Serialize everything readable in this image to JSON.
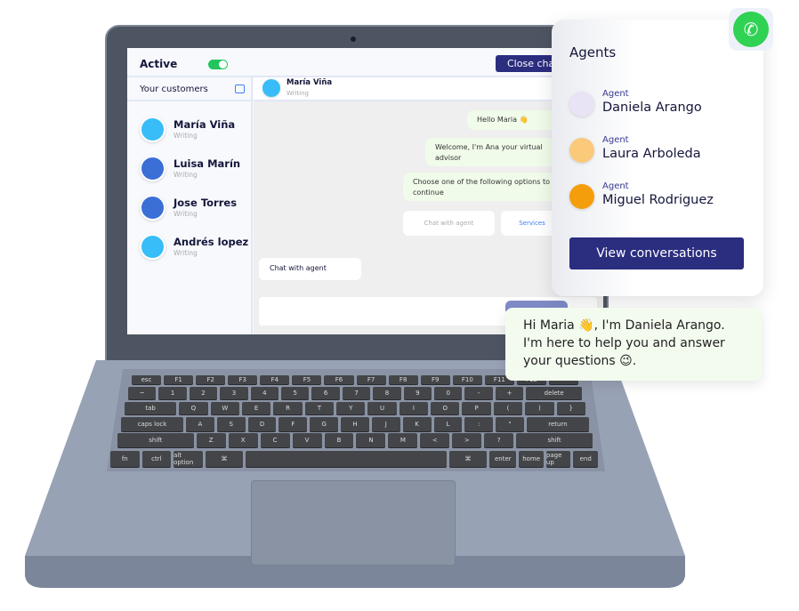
{
  "screen": {
    "active_label": "Active",
    "active_on": true,
    "close_chat": "Close chat",
    "your_customers": "Your customers",
    "customers": [
      {
        "name": "María Viña",
        "status": "Writing",
        "color": "#38bdf8"
      },
      {
        "name": "Luisa Marín",
        "status": "Writing",
        "color": "#3b6fd6"
      },
      {
        "name": "Jose Torres",
        "status": "Writing",
        "color": "#3b6fd6"
      },
      {
        "name": "Andrés lopez",
        "status": "Writing",
        "color": "#38bdf8"
      }
    ],
    "chat": {
      "contact_name": "María Viña",
      "contact_status": "Writing",
      "messages": [
        "Hello Maria 👋",
        "Welcome, I'm Ana your virtual advisor",
        "Choose one of the following options to continue"
      ],
      "options": [
        "Chat with agent",
        "Services"
      ],
      "user_reply": "Chat with agent"
    }
  },
  "agents": {
    "title": "Agents",
    "items": [
      {
        "label": "Agent",
        "name": "Daniela Arango",
        "color": "#e9e4f5"
      },
      {
        "label": "Agent",
        "name": "Laura Arboleda",
        "color": "#fbc97a"
      },
      {
        "label": "Agent",
        "name": "Miguel Rodriguez",
        "color": "#f59e0b"
      }
    ],
    "view_button": "View conversations"
  },
  "whatsapp": {
    "icon": "whatsapp-icon",
    "color": "#2fd253"
  },
  "agent_message": "Hi Maria 👋, I'm Daniela Arango. I'm here to help you and answer your questions 😉.",
  "keyboard": {
    "rows": [
      [
        "esc",
        "F1",
        "F2",
        "F3",
        "F4",
        "F5",
        "F6",
        "F7",
        "F8",
        "F9",
        "F10",
        "F11",
        "F12",
        ""
      ],
      [
        "~",
        "1",
        "2",
        "3",
        "4",
        "5",
        "6",
        "7",
        "8",
        "9",
        "0",
        "-",
        "+",
        "delete"
      ],
      [
        "tab",
        "Q",
        "W",
        "E",
        "R",
        "T",
        "Y",
        "U",
        "I",
        "O",
        "P",
        "(",
        ")",
        "}"
      ],
      [
        "caps lock",
        "A",
        "S",
        "D",
        "F",
        "G",
        "H",
        "J",
        "K",
        "L",
        ":",
        "\"",
        "return"
      ],
      [
        "shift",
        "Z",
        "X",
        "C",
        "V",
        "B",
        "N",
        "M",
        "<",
        ">",
        "?",
        "shift"
      ],
      [
        "fn",
        "ctrl",
        "alt option",
        "⌘",
        "",
        "⌘",
        "enter",
        "home",
        "page up",
        "end"
      ]
    ]
  },
  "colors": {
    "navy": "#2b2d7f",
    "bubble": "#f1fbea"
  }
}
